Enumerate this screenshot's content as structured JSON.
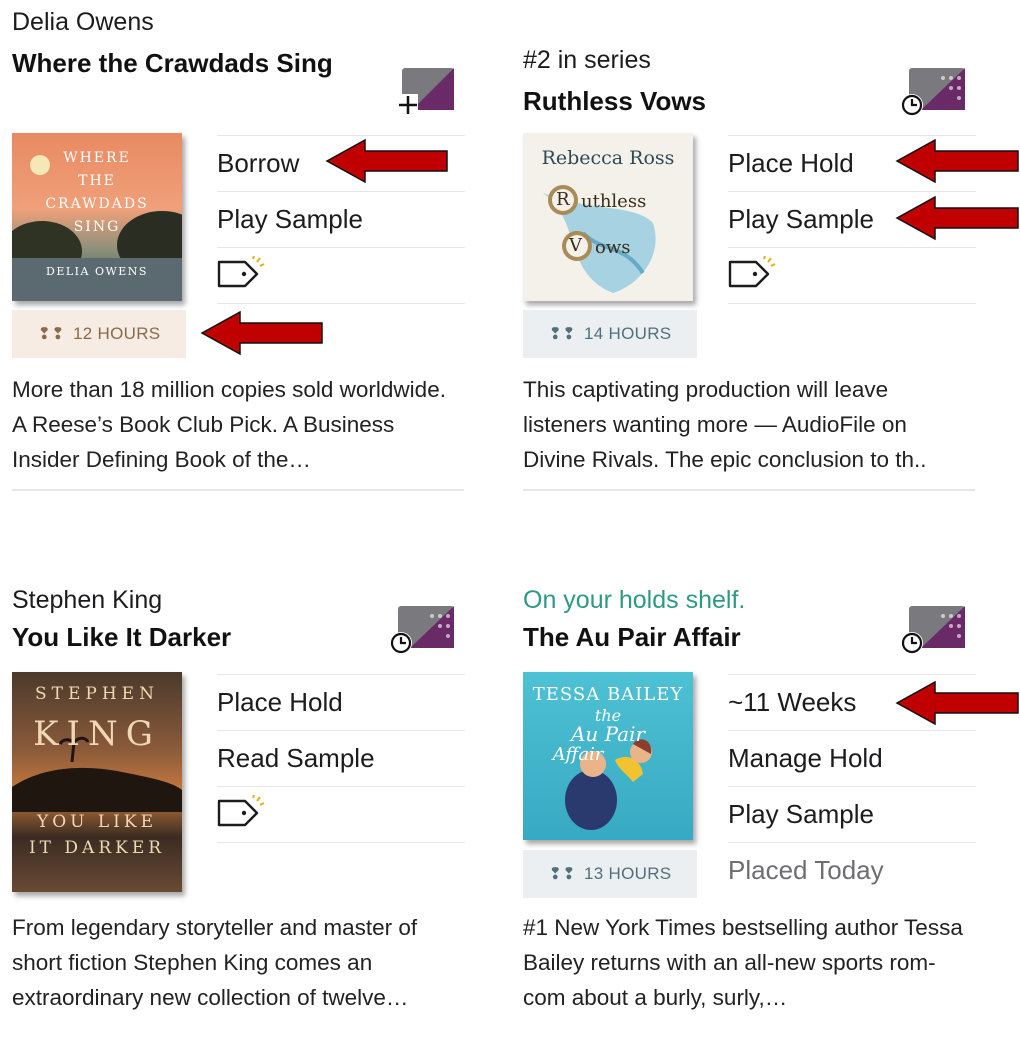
{
  "books": [
    {
      "subtitle": "Delia Owens",
      "title": "Where the Crawdads Sing",
      "cover": {
        "lines": [
          "WHERE",
          "THE",
          "CRAWDADS",
          "SING"
        ],
        "author": "DELIA OWENS"
      },
      "actions": [
        "Borrow",
        "Play Sample"
      ],
      "duration": "12 HOURS",
      "description": "More than 18 million copies sold worldwide. A Reese’s Book Club Pick. A Business Insider Defining Book of the…"
    },
    {
      "subtitle": "#2 in series",
      "title": "Ruthless Vows",
      "cover": {
        "author": "Rebecca Ross",
        "title_a": "uthless",
        "title_b": "ows",
        "initial_a": "R",
        "initial_b": "V"
      },
      "actions": [
        "Place Hold",
        "Play Sample"
      ],
      "duration": "14 HOURS",
      "description": "This captivating production will leave listeners wanting more — AudioFile on Divine Rivals. The epic conclusion to th.."
    },
    {
      "subtitle": "Stephen King",
      "title": "You Like It Darker",
      "cover": {
        "author_a": "STEPHEN",
        "author_b": "KING",
        "title_a": "YOU LIKE",
        "title_b": "IT DARKER"
      },
      "actions": [
        "Place Hold",
        "Read Sample"
      ],
      "description": "From legendary storyteller and master of short fiction Stephen King comes an extraordinary new collection of twelve…"
    },
    {
      "subtitle": "On your holds shelf.",
      "title": "The Au Pair Affair",
      "cover": {
        "author": "TESSA BAILEY",
        "title_a": "the",
        "title_b": "Au Pair",
        "title_c": "Affair"
      },
      "actions": [
        "~11 Weeks",
        "Manage Hold",
        "Play Sample",
        "Placed Today"
      ],
      "duration": "13 HOURS",
      "description": "#1 New York Times bestselling author Tessa Bailey returns with an all-new sports rom-com about a burly, surly,…"
    }
  ],
  "icons": {
    "shelf_add": "shelf-add-icon",
    "shelf_hold": "shelf-hold-icon",
    "tag": "tag-icon",
    "headphones": "headphones-icon",
    "annotation_arrow": "red-arrow"
  },
  "colors": {
    "accent_purple": "#6a2a68",
    "teal_status": "#2e9a86",
    "warm_badge_bg": "#f6ece3",
    "cool_badge_bg": "#ebeff1",
    "arrow_red": "#c00000"
  }
}
